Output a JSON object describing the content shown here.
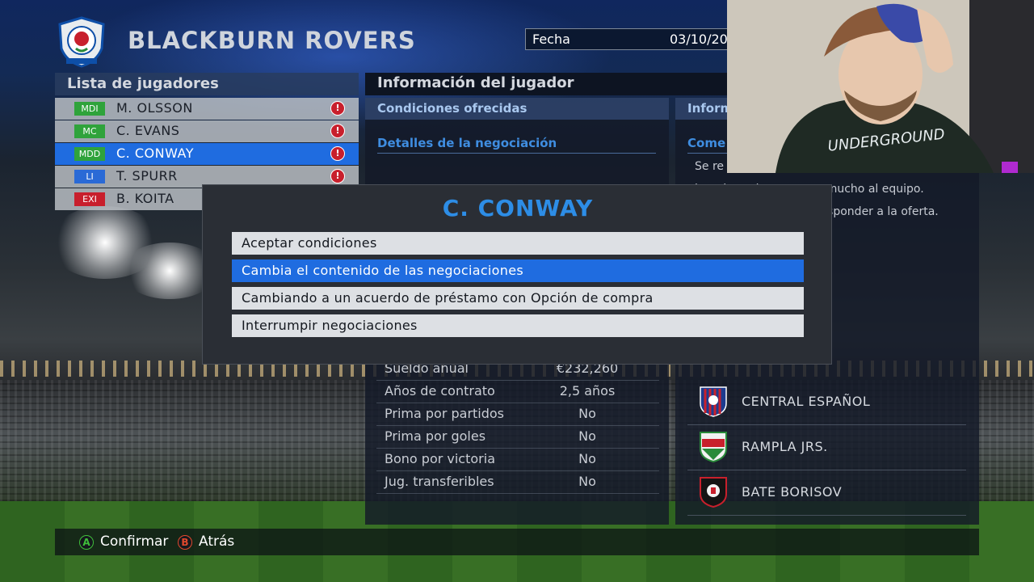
{
  "header": {
    "team_name": "BLACKBURN ROVERS",
    "date_label": "Fecha",
    "date_value": "03/10/20",
    "crest_text": "ARTE ET LABORE"
  },
  "player_list": {
    "title": "Lista de jugadores",
    "players": [
      {
        "pos": "MDI",
        "name": "M. OLSSON",
        "pos_color": "green",
        "selected": false,
        "alert": true
      },
      {
        "pos": "MC",
        "name": "C. EVANS",
        "pos_color": "green",
        "selected": false,
        "alert": true
      },
      {
        "pos": "MDD",
        "name": "C. CONWAY",
        "pos_color": "green",
        "selected": true,
        "alert": true
      },
      {
        "pos": "LI",
        "name": "T. SPURR",
        "pos_color": "blue",
        "selected": false,
        "alert": true
      },
      {
        "pos": "EXI",
        "name": "B. KOITA",
        "pos_color": "red",
        "selected": false,
        "alert": false
      }
    ]
  },
  "player_info": {
    "title": "Información del jugador",
    "conditions_title": "Condiciones ofrecidas",
    "negotiation_title": "Detalles de la negociación",
    "contract": [
      {
        "label": "Sueldo anual",
        "value": "€232,260"
      },
      {
        "label": "Años de contrato",
        "value": "2,5 años"
      },
      {
        "label": "Prima por partidos",
        "value": "No"
      },
      {
        "label": "Prima por goles",
        "value": "No"
      },
      {
        "label": "Bono por victoria",
        "value": "No"
      },
      {
        "label": "Jug. transferibles",
        "value": "No"
      }
    ]
  },
  "right_panel": {
    "title": "Inform",
    "comment_title": "Come",
    "comment_lines": [
      "Se re",
      "jugador quiere aportar mucho al equipo.",
      "responder a la oferta."
    ],
    "clubs": [
      {
        "name": "CENTRAL ESPAÑOL"
      },
      {
        "name": "RAMPLA JRS."
      },
      {
        "name": "BATE BORISOV"
      }
    ]
  },
  "modal": {
    "title": "C. CONWAY",
    "options": [
      {
        "label": "Aceptar condiciones",
        "selected": false
      },
      {
        "label": "Cambia el contenido de las negociaciones",
        "selected": true
      },
      {
        "label": "Cambiando a un acuerdo de préstamo con Opción de compra",
        "selected": false
      },
      {
        "label": "Interrumpir negociaciones",
        "selected": false
      }
    ]
  },
  "footer": {
    "confirm_key": "A",
    "confirm_label": "Confirmar",
    "back_key": "B",
    "back_label": "Atrás"
  },
  "colors": {
    "accent_blue": "#1f6ce0",
    "title_blue": "#2d8de6",
    "alert_red": "#c81f2c"
  }
}
